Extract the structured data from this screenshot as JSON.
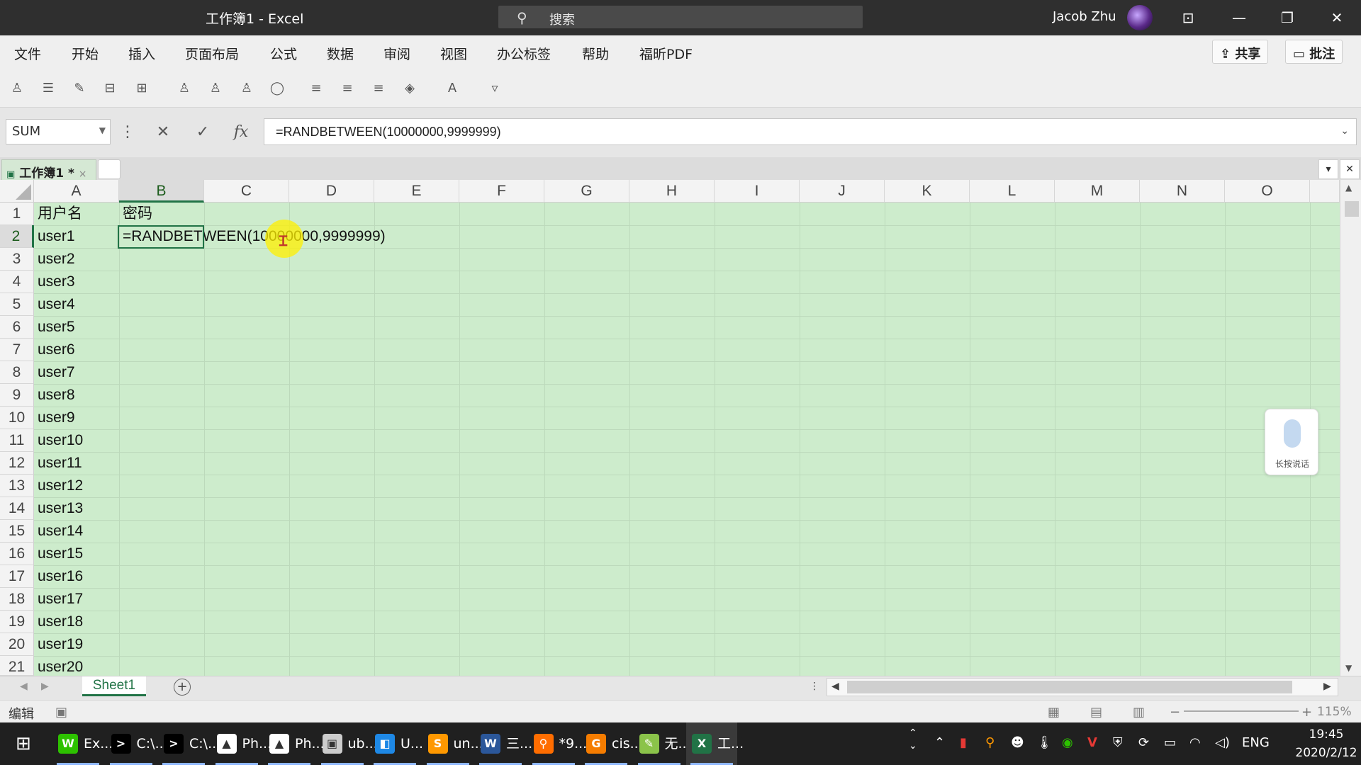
{
  "window": {
    "title": "工作簿1  -  Excel",
    "search_placeholder": "搜索",
    "user_name": "Jacob Zhu"
  },
  "menu": [
    "文件",
    "开始",
    "插入",
    "页面布局",
    "公式",
    "数据",
    "审阅",
    "视图",
    "办公标签",
    "帮助",
    "福昕PDF"
  ],
  "actions": {
    "share": "共享",
    "comment": "批注"
  },
  "formula_bar": {
    "name_box": "SUM",
    "fx": "fx",
    "formula": "=RANDBETWEEN(10000000,9999999)"
  },
  "workbook_tab": {
    "label": "工作簿1 *",
    "close": "×"
  },
  "columns": [
    "A",
    "B",
    "C",
    "D",
    "E",
    "F",
    "G",
    "H",
    "I",
    "J",
    "K",
    "L",
    "M",
    "N",
    "O"
  ],
  "active": {
    "column": "B",
    "row": "2"
  },
  "rows": [
    "1",
    "2",
    "3",
    "4",
    "5",
    "6",
    "7",
    "8",
    "9",
    "10",
    "11",
    "12",
    "13",
    "14",
    "15",
    "16",
    "17",
    "18",
    "19",
    "20",
    "21"
  ],
  "cells": {
    "A1": "用户名",
    "B1": "密码",
    "A2": "user1",
    "B2": "=RANDBETWEEN(10000000,9999999)",
    "A3": "user2",
    "A4": "user3",
    "A5": "user4",
    "A6": "user5",
    "A7": "user6",
    "A8": "user7",
    "A9": "user8",
    "A10": "user9",
    "A11": "user10",
    "A12": "user11",
    "A13": "user12",
    "A14": "user13",
    "A15": "user14",
    "A16": "user15",
    "A17": "user16",
    "A18": "user17",
    "A19": "user18",
    "A20": "user19",
    "A21": "user20"
  },
  "voice_widget": {
    "label": "长按说话",
    "icon": "microphone-icon"
  },
  "sheets": [
    {
      "name": "Sheet1",
      "active": true
    }
  ],
  "status": {
    "mode": "编辑",
    "zoom": "115%"
  },
  "taskbar": {
    "items": [
      {
        "label": "Ex...",
        "icon": "wechat-icon",
        "color": "#2dc100",
        "glyph": "W"
      },
      {
        "label": "C:\\...",
        "icon": "terminal-icon",
        "color": "#000000",
        "glyph": ">"
      },
      {
        "label": "C:\\...",
        "icon": "terminal-icon",
        "color": "#000000",
        "glyph": ">"
      },
      {
        "label": "Ph...",
        "icon": "photos-icon",
        "color": "#ffffff",
        "glyph": "▲"
      },
      {
        "label": "Ph...",
        "icon": "photos-icon",
        "color": "#ffffff",
        "glyph": "▲"
      },
      {
        "label": "ub...",
        "icon": "vm-icon",
        "color": "#cccccc",
        "glyph": "▣"
      },
      {
        "label": "U...",
        "icon": "network-icon",
        "color": "#1e88e5",
        "glyph": "◧"
      },
      {
        "label": "un...",
        "icon": "sublime-icon",
        "color": "#ff9800",
        "glyph": "S"
      },
      {
        "label": "三...",
        "icon": "word-icon",
        "color": "#2b579a",
        "glyph": "W"
      },
      {
        "label": "*9...",
        "icon": "search-tool-icon",
        "color": "#ff6d00",
        "glyph": "⚲"
      },
      {
        "label": "cis...",
        "icon": "foxit-icon",
        "color": "#f57c00",
        "glyph": "G"
      },
      {
        "label": "无...",
        "icon": "paint-icon",
        "color": "#8bc34a",
        "glyph": "✎"
      },
      {
        "label": "工...",
        "icon": "excel-icon",
        "color": "#217346",
        "glyph": "X"
      }
    ],
    "lang": "ENG",
    "time": "19:45",
    "date": "2020/2/12"
  }
}
